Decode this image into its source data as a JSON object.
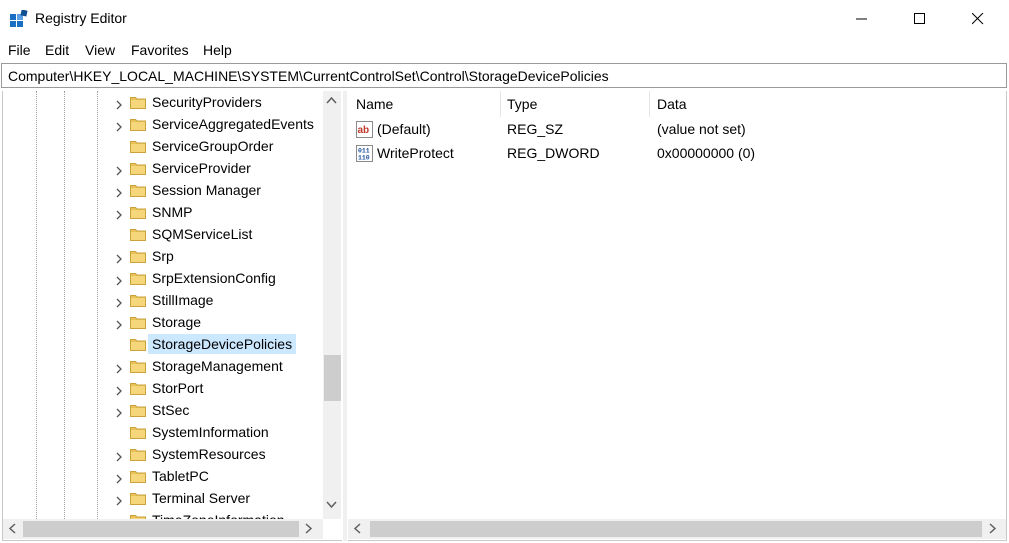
{
  "window": {
    "title": "Registry Editor",
    "icon": "registry-editor-icon"
  },
  "menu": [
    {
      "label": "File"
    },
    {
      "label": "Edit"
    },
    {
      "label": "View"
    },
    {
      "label": "Favorites"
    },
    {
      "label": "Help"
    }
  ],
  "address": "Computer\\HKEY_LOCAL_MACHINE\\SYSTEM\\CurrentControlSet\\Control\\StorageDevicePolicies",
  "tree": {
    "items": [
      {
        "label": "SecurityProviders",
        "expandable": true
      },
      {
        "label": "ServiceAggregatedEvents",
        "expandable": true
      },
      {
        "label": "ServiceGroupOrder",
        "expandable": false
      },
      {
        "label": "ServiceProvider",
        "expandable": true
      },
      {
        "label": "Session Manager",
        "expandable": true
      },
      {
        "label": "SNMP",
        "expandable": true
      },
      {
        "label": "SQMServiceList",
        "expandable": false
      },
      {
        "label": "Srp",
        "expandable": true
      },
      {
        "label": "SrpExtensionConfig",
        "expandable": true
      },
      {
        "label": "StillImage",
        "expandable": true
      },
      {
        "label": "Storage",
        "expandable": true
      },
      {
        "label": "StorageDevicePolicies",
        "expandable": false,
        "selected": true
      },
      {
        "label": "StorageManagement",
        "expandable": true
      },
      {
        "label": "StorPort",
        "expandable": true
      },
      {
        "label": "StSec",
        "expandable": true
      },
      {
        "label": "SystemInformation",
        "expandable": false
      },
      {
        "label": "SystemResources",
        "expandable": true
      },
      {
        "label": "TabletPC",
        "expandable": true
      },
      {
        "label": "Terminal Server",
        "expandable": true
      },
      {
        "label": "TimeZoneInformation",
        "expandable": false
      }
    ]
  },
  "columns": {
    "name": "Name",
    "type": "Type",
    "data": "Data"
  },
  "values": [
    {
      "name": "(Default)",
      "type": "REG_SZ",
      "data": "(value not set)",
      "icon": "string-value-icon"
    },
    {
      "name": "WriteProtect",
      "type": "REG_DWORD",
      "data": "0x00000000 (0)",
      "icon": "binary-value-icon"
    }
  ],
  "colors": {
    "selection": "#cce8ff",
    "folder": "#e8c15a",
    "scroll_track": "#f0f0f0",
    "scroll_thumb": "#cdcdcd"
  }
}
